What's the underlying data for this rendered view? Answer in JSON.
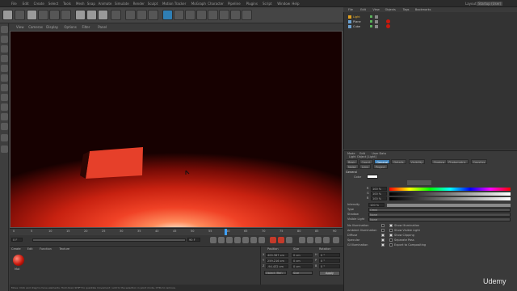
{
  "menubar": {
    "items": [
      "File",
      "Edit",
      "Create",
      "Select",
      "Tools",
      "Mesh",
      "Snap",
      "Animate",
      "Simulate",
      "Render",
      "Sculpt",
      "Motion Tracker",
      "MoGraph",
      "Character",
      "Pipeline",
      "Plugins",
      "Script",
      "Window",
      "Help"
    ],
    "layout_label": "Layout:",
    "layout_value": "Startup (User)"
  },
  "viewport_menu": [
    "View",
    "Cameras",
    "Display",
    "Options",
    "Filter",
    "Panel"
  ],
  "object_manager": {
    "menu": [
      "File",
      "Edit",
      "View",
      "Objects",
      "Tags",
      "Bookmarks"
    ],
    "objects": [
      {
        "name": "Light",
        "color": "#e0a020"
      },
      {
        "name": "Plane",
        "color": "#6aa0d0"
      },
      {
        "name": "Cube",
        "color": "#6aa0d0"
      }
    ]
  },
  "attributes": {
    "menu": [
      "Mode",
      "Edit",
      "User Data"
    ],
    "title": "Light Object [Light]",
    "tabs": [
      "Basic",
      "Coord.",
      "General",
      "Details",
      "Visibility",
      "Shadow",
      "Photometric",
      "Caustics",
      "Noise",
      "Lens",
      "Project"
    ],
    "active_tab": "General",
    "section": "General",
    "color_label": "Color",
    "rgb": [
      {
        "label": "R",
        "value": "100 %"
      },
      {
        "label": "G",
        "value": "100 %"
      },
      {
        "label": "B",
        "value": "100 %"
      }
    ],
    "intensity": {
      "label": "Intensity",
      "value": "100 %"
    },
    "type": {
      "label": "Type",
      "value": "Omni"
    },
    "shadow": {
      "label": "Shadow",
      "value": "None"
    },
    "visible_light": {
      "label": "Visible Light",
      "value": "None"
    },
    "left_options": [
      "No Illumination",
      "Ambient Illumination",
      "Diffuse",
      "Specular",
      "GI Illumination"
    ],
    "right_options": [
      "Show Illumination",
      "Show Visible Light",
      "Show Clipping",
      "Separate Pass",
      "Export to Compositing"
    ]
  },
  "timeline": {
    "ticks": [
      "0",
      "5",
      "10",
      "15",
      "20",
      "25",
      "30",
      "35",
      "40",
      "45",
      "50",
      "55",
      "60",
      "65",
      "70",
      "75",
      "80",
      "85",
      "90"
    ],
    "frame_current": "0 F",
    "frame_end": "90 F"
  },
  "material": {
    "menu": [
      "Create",
      "Edit",
      "Function",
      "Texture"
    ],
    "name": "Mat"
  },
  "coordinates": {
    "headers": [
      "Position",
      "Size",
      "Rotation"
    ],
    "rows": [
      {
        "axis": "X",
        "pos": "400.367 cm",
        "size": "0 cm",
        "rot_axis": "H",
        "rot": "0 °"
      },
      {
        "axis": "Y",
        "pos": "259.216 cm",
        "size": "0 cm",
        "rot_axis": "P",
        "rot": "0 °"
      },
      {
        "axis": "Z",
        "pos": "-94.432 cm",
        "size": "0 cm",
        "rot_axis": "B",
        "rot": "0 °"
      }
    ],
    "mode": "Object (Rel)",
    "size_mode": "Size",
    "apply": "Apply"
  },
  "statusbar": "Move: Click and drag to move elements. Hold down SHIFT to quantize movement / add to the selection in point mode, CTRL to remove.",
  "watermark": "Udemy",
  "colors": {
    "accent": "#3f80b8",
    "viewport_red": "#e03a20"
  }
}
